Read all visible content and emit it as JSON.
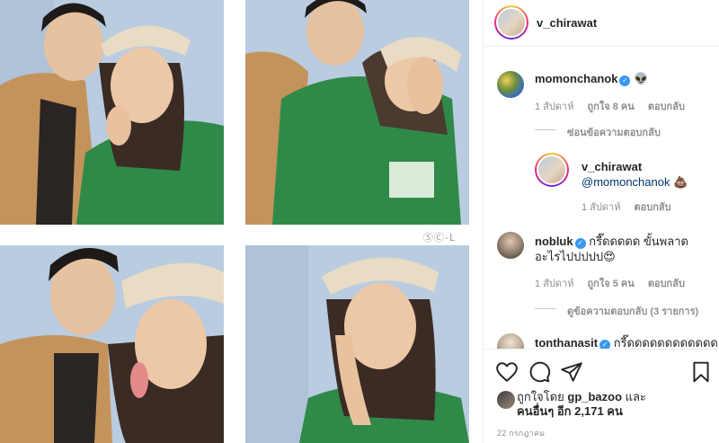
{
  "post": {
    "author": "v_chirawat",
    "watermark": "ⓈⒸ-L"
  },
  "comments": [
    {
      "user": "momonchanok",
      "verified": true,
      "text": "👽",
      "time": "1 สัปดาห์",
      "likes": "ถูกใจ 8 คน",
      "reply_label": "ตอบกลับ",
      "hide_replies": "ซ่อนข้อความตอบกลับ",
      "avatar_color": "#6b8f3a"
    },
    {
      "user": "v_chirawat",
      "verified": false,
      "mention": "@momonchanok",
      "text": "💩",
      "time": "1 สัปดาห์",
      "reply_label": "ตอบกลับ"
    },
    {
      "user": "nobluk",
      "verified": true,
      "text": "กรี๊ดดดดด ขั้นพลาดอะไรไปปปปป😍",
      "time": "1 สัปดาห์",
      "likes": "ถูกใจ 5 คน",
      "reply_label": "ตอบกลับ",
      "view_replies": "ดูข้อความตอบกลับ (3 รายการ)",
      "avatar_color": "#8c7b6b"
    },
    {
      "user": "tonthanasit",
      "verified": true,
      "text": "กรี๊ดดดดดดดดดดดด",
      "avatar_color": "#b9a58f"
    }
  ],
  "actions": {
    "icons": [
      "heart-icon",
      "comment-icon",
      "share-icon",
      "bookmark-icon"
    ]
  },
  "likes_line": {
    "prefix": "ถูกใจโดย",
    "user": "gp_bazoo",
    "conj": "และ",
    "others": "คนอื่นๆ อีก 2,171 คน"
  },
  "date": "22 กรกฎาคม",
  "colors": {
    "verified": "#3897f0",
    "muted": "#8e8e8e",
    "text": "#262626",
    "mention": "#00376b"
  }
}
